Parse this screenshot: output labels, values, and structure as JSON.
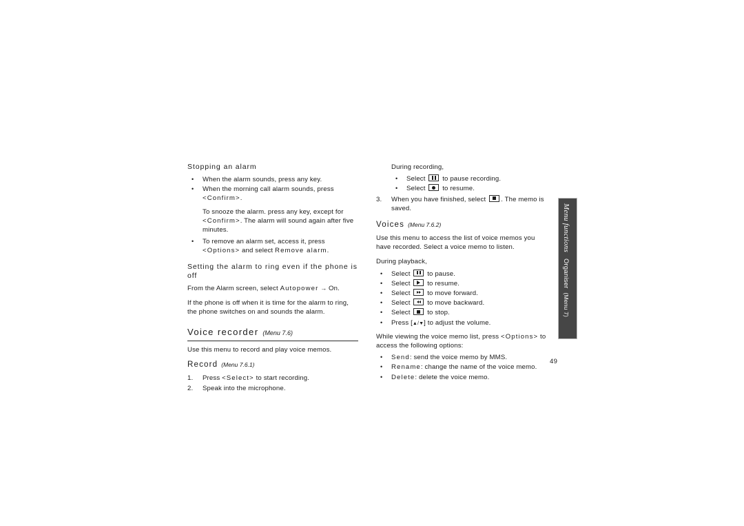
{
  "document": {
    "page_number": "49"
  },
  "side_tab": {
    "title": "Menu functions",
    "section": "Organiser",
    "menu_ref": "(Menu 7)",
    "background_color": "#464646",
    "text_color": "#ffffff"
  },
  "left_column": {
    "stopping_alarm": {
      "heading": "Stopping an alarm",
      "bullets": [
        {
          "text": "When the alarm sounds, press any key."
        },
        {
          "text_before": "When the morning call alarm sounds, press ",
          "keyword": "<Confirm>",
          "text_after": "."
        },
        {
          "text": "To snooze the alarm. press any key, except for"
        },
        {
          "keyword": "<Confirm>",
          "text_after": ". The alarm will sound again after five minutes."
        },
        {
          "text_before": "To remove an alarm set, access it, press ",
          "keyword": "<Options>",
          "text_mid": " and select ",
          "keyword2": "Remove alarm",
          "text_after": "."
        }
      ]
    },
    "autopower": {
      "heading": "Setting the alarm to ring even if the phone is off",
      "para1_before": "From the Alarm screen, select ",
      "para1_keyword": "Autopower",
      "para1_arrow": "→",
      "para1_after": " On.",
      "para2": "If the phone is off when it is time for the alarm to ring, the phone switches on and sounds the alarm."
    },
    "voice_recorder": {
      "heading": "Voice recorder",
      "menu_ref": "(Menu 7.6)",
      "intro": "Use this menu to record and play voice memos.",
      "record": {
        "heading": "Record",
        "menu_ref": "(Menu 7.6.1)",
        "steps": [
          {
            "num": "1.",
            "text_before": "Press ",
            "keyword": "<Select>",
            "text_after": " to start recording."
          },
          {
            "num": "2.",
            "text": "Speak into the microphone."
          }
        ]
      }
    }
  },
  "right_column": {
    "during_recording": {
      "lead": "During recording,",
      "bullets": [
        {
          "text_before": "Select ",
          "icon": "pause-icon",
          "text_after": " to pause recording."
        },
        {
          "text_before": "Select ",
          "icon": "record-icon",
          "text_after": " to resume."
        }
      ]
    },
    "step3": {
      "num": "3.",
      "text_before": "When you have finished, select ",
      "icon": "stop-icon",
      "text_after": ". The memo is saved."
    },
    "voices": {
      "heading": "Voices",
      "menu_ref": "(Menu 7.6.2)",
      "intro": "Use this menu to access the list of voice memos you have recorded. Select a voice memo to listen.",
      "playback_lead": "During playback,",
      "playback_bullets": [
        {
          "text_before": "Select ",
          "icon": "pause-icon",
          "text_after": " to pause."
        },
        {
          "text_before": "Select ",
          "icon": "play-icon",
          "text_after": " to resume."
        },
        {
          "text_before": "Select ",
          "icon": "forward-icon",
          "text_after": " to move forward."
        },
        {
          "text_before": "Select ",
          "icon": "rewind-icon",
          "text_after": " to move backward."
        },
        {
          "text_before": "Select ",
          "icon": "stop-icon",
          "text_after": " to stop."
        },
        {
          "text_before": "Press [",
          "icon": "up-down-arrow-icon",
          "text_after": "] to adjust the volume."
        }
      ],
      "options_intro_before": "While viewing the voice memo list, press ",
      "options_intro_keyword": "<Options>",
      "options_intro_after": " to access the following options:",
      "options": [
        {
          "keyword": "Send",
          "text": ": send the voice memo by MMS."
        },
        {
          "keyword": "Rename",
          "text": ": change the name of the voice memo."
        },
        {
          "keyword": "Delete",
          "text": ": delete the voice memo."
        }
      ]
    }
  }
}
